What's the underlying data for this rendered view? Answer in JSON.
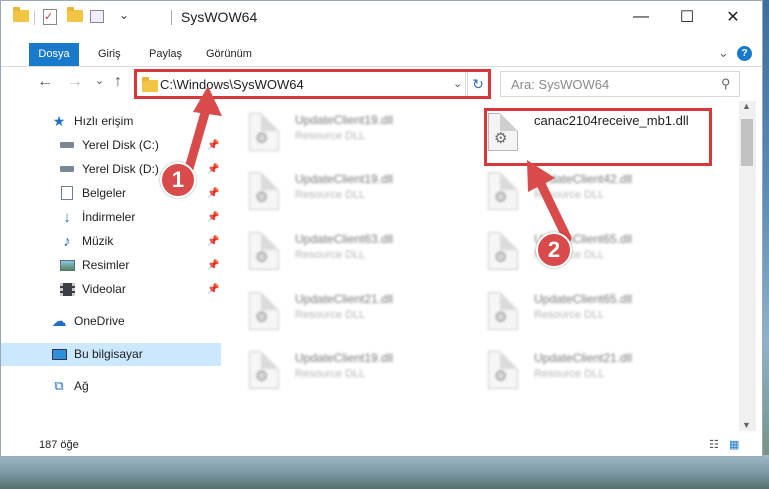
{
  "window": {
    "title": "SysWOW64",
    "minimize_glyph": "—",
    "maximize_glyph": "☐",
    "close_glyph": "✕"
  },
  "ribbon": {
    "tabs": [
      "Dosya",
      "Giriş",
      "Paylaş",
      "Görünüm"
    ],
    "expand_glyph": "⌄",
    "help_glyph": "?"
  },
  "nav": {
    "back_glyph": "←",
    "forward_glyph": "→",
    "recent_glyph": "⌄",
    "up_glyph": "↑",
    "address": "C:\\Windows\\SysWOW64",
    "address_dropdown_glyph": "⌄",
    "refresh_glyph": "↻",
    "search_placeholder": "Ara: SysWOW64",
    "search_glyph": "⚲"
  },
  "sidebar": {
    "items": [
      {
        "label": "Hızlı erişim",
        "icon": "star-icon"
      },
      {
        "label": "Yerel Disk (C:)",
        "icon": "drive-icon",
        "pinned": true
      },
      {
        "label": "Yerel Disk (D:)",
        "icon": "drive-icon",
        "pinned": true
      },
      {
        "label": "Belgeler",
        "icon": "documents-icon",
        "pinned": true
      },
      {
        "label": "İndirmeler",
        "icon": "download-icon",
        "pinned": true
      },
      {
        "label": "Müzik",
        "icon": "music-icon",
        "pinned": true
      },
      {
        "label": "Resimler",
        "icon": "pictures-icon",
        "pinned": true
      },
      {
        "label": "Videolar",
        "icon": "videos-icon",
        "pinned": true
      },
      {
        "label": "OneDrive",
        "icon": "cloud-icon"
      },
      {
        "label": "Bu bilgisayar",
        "icon": "computer-icon",
        "selected": true
      },
      {
        "label": "Ağ",
        "icon": "network-icon"
      }
    ]
  },
  "files": [
    {
      "name": "UpdateClient19.dll",
      "type": "Resource DLL"
    },
    {
      "name": "canac2104receive_mb1.dll",
      "type": ""
    },
    {
      "name": "UpdateClient19.dll",
      "type": "Resource DLL"
    },
    {
      "name": "UpdateClient42.dll",
      "type": "Resource DLL"
    },
    {
      "name": "UpdateClient63.dll",
      "type": "Resource DLL"
    },
    {
      "name": "UpdateClient65.dll",
      "type": "Resource DLL"
    },
    {
      "name": "UpdateClient21.dll",
      "type": "Resource DLL"
    },
    {
      "name": "UpdateClient65.dll",
      "type": "Resource DLL"
    },
    {
      "name": "UpdateClient19.dll",
      "type": "Resource DLL"
    },
    {
      "name": "UpdateClient21.dll",
      "type": "Resource DLL"
    }
  ],
  "status": {
    "item_count": "187 öğe",
    "details_view_glyph": "☷",
    "icons_view_glyph": "▦"
  },
  "callouts": [
    "1",
    "2"
  ],
  "colors": {
    "accent": "#1979ca",
    "highlight": "#d9383a",
    "selected_bg": "#cce8ff"
  }
}
